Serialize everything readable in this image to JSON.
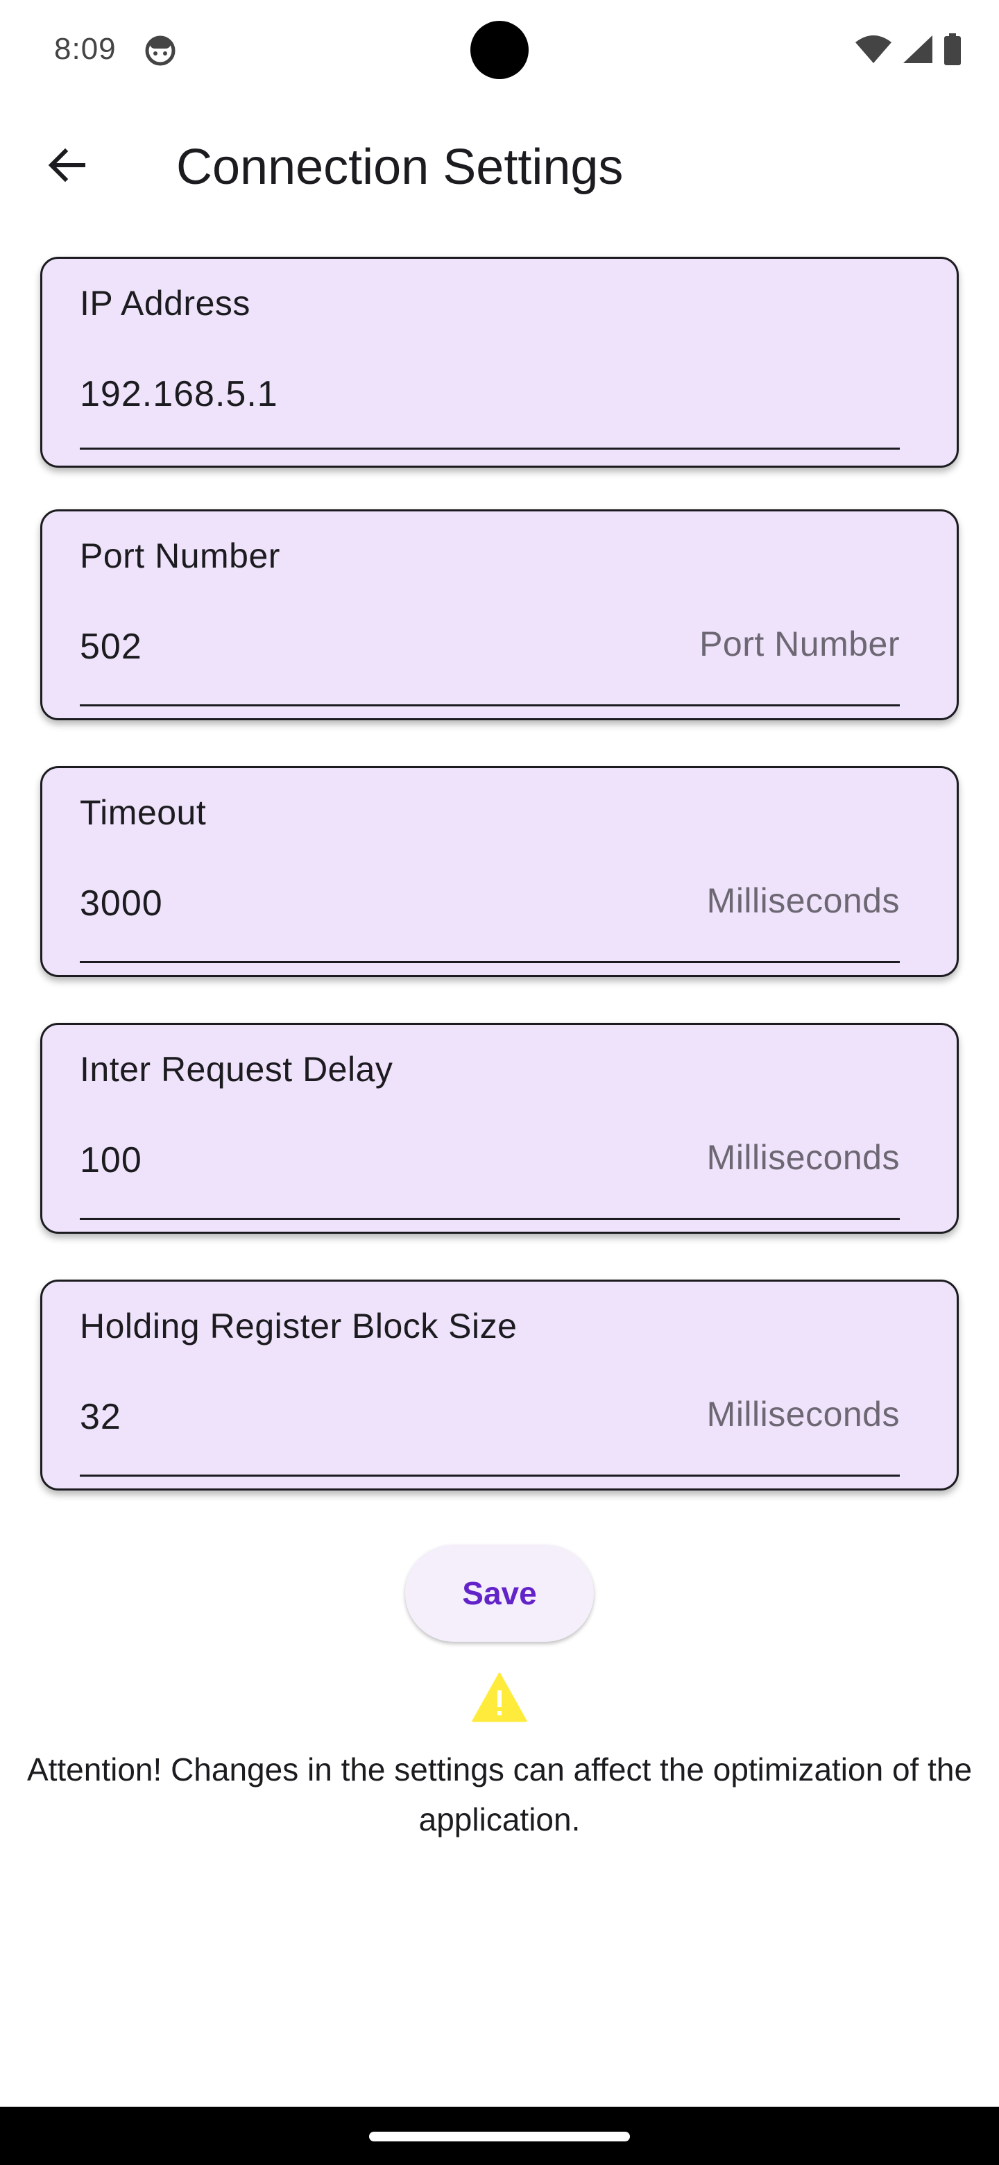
{
  "status_bar": {
    "time": "8:09",
    "icons": [
      "android-face-icon",
      "wifi-icon",
      "signal-icon",
      "battery-icon"
    ]
  },
  "app_bar": {
    "title": "Connection Settings",
    "back_icon": "arrow-back-icon"
  },
  "fields": [
    {
      "label": "IP Address",
      "value": "192.168.5.1",
      "suffix": ""
    },
    {
      "label": "Port Number",
      "value": "502",
      "suffix": "Port Number"
    },
    {
      "label": "Timeout",
      "value": "3000",
      "suffix": "Milliseconds"
    },
    {
      "label": "Inter Request Delay",
      "value": "100",
      "suffix": "Milliseconds"
    },
    {
      "label": "Holding Register Block Size",
      "value": "32",
      "suffix": "Milliseconds"
    }
  ],
  "save_button": {
    "label": "Save"
  },
  "warning": {
    "icon": "warning-icon",
    "text": "Attention! Changes in the settings can affect the optimization of the application."
  },
  "colors": {
    "card_background": "#eee3fa",
    "accent": "#6224c9",
    "warning": "#ffeb3b"
  }
}
